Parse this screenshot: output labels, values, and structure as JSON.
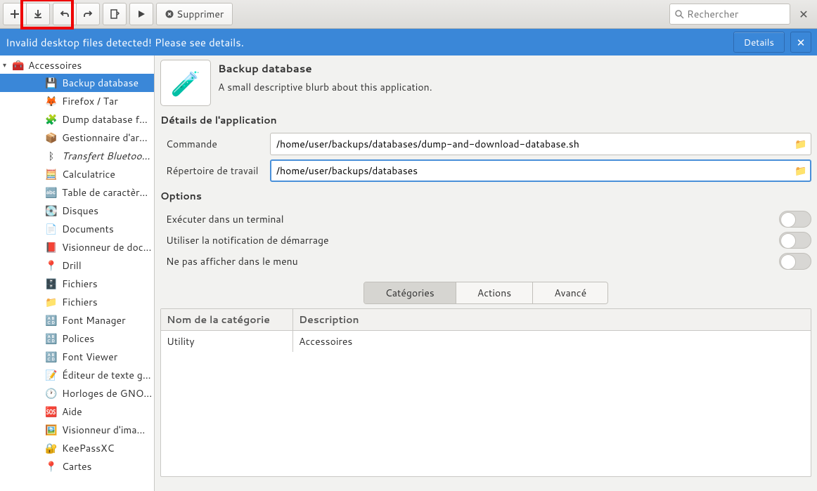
{
  "toolbar": {
    "delete_label": "Supprimer",
    "search_placeholder": "Rechercher"
  },
  "banner": {
    "message": "Invalid desktop files detected! Please see details.",
    "details_label": "Details"
  },
  "sidebar": {
    "category": "Accessoires",
    "items": [
      {
        "label": "Backup database",
        "icon": "💾",
        "sel": true
      },
      {
        "label": "Firefox / Tar",
        "icon": "🦊"
      },
      {
        "label": "Dump database f...",
        "icon": "🧩"
      },
      {
        "label": "Gestionnaire d'ar...",
        "icon": "📦"
      },
      {
        "label": "Transfert Bluetoo...",
        "icon": "ᛒ",
        "italic": true
      },
      {
        "label": "Calculatrice",
        "icon": "🧮"
      },
      {
        "label": "Table de caractèr...",
        "icon": "🔤"
      },
      {
        "label": "Disques",
        "icon": "💽"
      },
      {
        "label": "Documents",
        "icon": "📄"
      },
      {
        "label": "Visionneur de doc...",
        "icon": "📕"
      },
      {
        "label": "Drill",
        "icon": "📍"
      },
      {
        "label": "Fichiers",
        "icon": "🗄️"
      },
      {
        "label": "Fichiers",
        "icon": "📁"
      },
      {
        "label": "Font Manager",
        "icon": "🔠"
      },
      {
        "label": "Polices",
        "icon": "🔠"
      },
      {
        "label": "Font Viewer",
        "icon": "🔠"
      },
      {
        "label": "Éditeur de texte g...",
        "icon": "📝"
      },
      {
        "label": "Horloges de GNO...",
        "icon": "🕐"
      },
      {
        "label": "Aide",
        "icon": "🆘"
      },
      {
        "label": "Visionneur d'ima...",
        "icon": "🖼️"
      },
      {
        "label": "KeePassXC",
        "icon": "🔐"
      },
      {
        "label": "Cartes",
        "icon": "📍"
      }
    ]
  },
  "app": {
    "title": "Backup database",
    "description": "A small descriptive blurb about this application."
  },
  "details": {
    "section": "Détails de l'application",
    "command_label": "Commande",
    "command_value": "/home/user/backups/databases/dump-and-download-database.sh",
    "workdir_label": "Répertoire de travail",
    "workdir_value": "/home/user/backups/databases"
  },
  "options": {
    "section": "Options",
    "terminal": "Exécuter dans un terminal",
    "notify": "Utiliser la notification de démarrage",
    "hide": "Ne pas afficher dans le menu"
  },
  "tabs": {
    "categories": "Catégories",
    "actions": "Actions",
    "advanced": "Avancé"
  },
  "cat_table": {
    "col_name": "Nom de la catégorie",
    "col_desc": "Description",
    "row_name": "Utility",
    "row_desc": "Accessoires"
  }
}
